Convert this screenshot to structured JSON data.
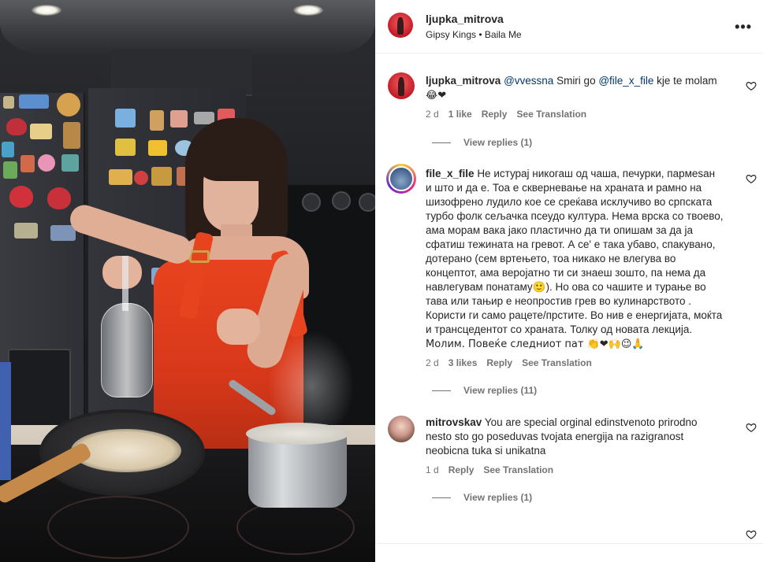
{
  "post": {
    "author": "ljupka_mitrova",
    "audio_artist": "Gipsy Kings",
    "audio_separator": "•",
    "audio_track": "Baila Me",
    "more_label": "•••"
  },
  "comments": [
    {
      "username": "ljupka_mitrova",
      "mention1": "@vvessna",
      "text1": "Smiri go",
      "mention2": "@file_x_file",
      "text2": "kje te molam",
      "emojis": "😂❤",
      "time": "2 d",
      "likes": "1 like",
      "reply_label": "Reply",
      "translate_label": "See Translation",
      "view_replies": "View replies (1)"
    },
    {
      "username": "file_x_file",
      "lines": [
        "Не истурај никогаш од чаша, печурки, пармеѕан",
        "и што и да е. Тоа е скверне­вање на храната и рамно на",
        "шизофрено лудило кое се среќава исклучиво во српската",
        "турбо фолк сељачка псеудо култура. Нема врска со твоево,",
        "ама морам вака јако пластично да ти опишам за да ја",
        "сфатиш тежината на гревот. А се' е така убаво, спакувано,",
        "дотерано (сем вртењето, тоа никако не влегува во",
        "концептот, ама веројатно ти си знаеш зошто, па нема да",
        "навлегувам понатаму🙂). Но ова со чашите и турање во",
        "тава или тањир е неопростив грев во кулинарството .",
        "Користи ги само рацете/прстите. Во нив е енергијата, моќта",
        "и трансцедентот со храната. Толку од новата лекција.",
        "Молим. Повеќе следниот пат 👏❤🙌😉🙏"
      ],
      "time": "2 d",
      "likes": "3 likes",
      "reply_label": "Reply",
      "translate_label": "See Translation",
      "view_replies": "View replies (11)"
    },
    {
      "username": "mitrovskav",
      "lines": [
        "You are special orginal edinstvenoto prirodno",
        "nesto sto go poseduvas tvojata energija na razigranost",
        "neobicna tuka si unikatna"
      ],
      "time": "1 d",
      "reply_label": "Reply",
      "translate_label": "See Translation",
      "view_replies": "View replies (1)"
    }
  ],
  "icons": {
    "like": "heart-icon",
    "more": "more-options-icon"
  },
  "colors": {
    "link": "#00376b",
    "secondary_text": "#737373",
    "primary_text": "#262626",
    "divider": "#efefef"
  }
}
